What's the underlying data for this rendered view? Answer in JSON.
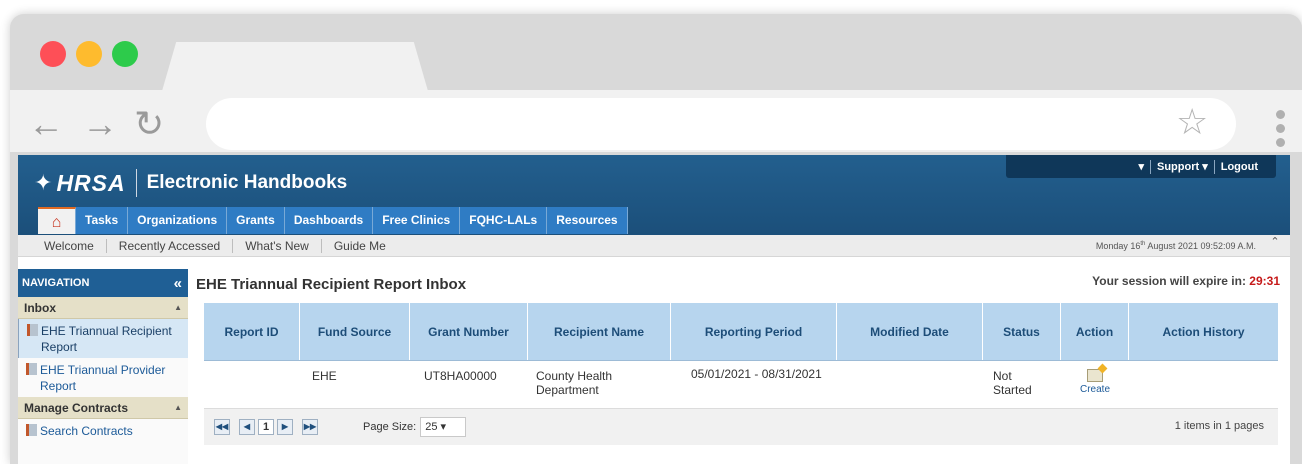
{
  "header": {
    "logo_text": "HRSA",
    "app_title": "Electronic Handbooks",
    "support": "Support",
    "logout": "Logout"
  },
  "menu": [
    "Tasks",
    "Organizations",
    "Grants",
    "Dashboards",
    "Free Clinics",
    "FQHC-LALs",
    "Resources"
  ],
  "subnav": [
    "Welcome",
    "Recently Accessed",
    "What's New",
    "Guide Me"
  ],
  "date": {
    "day_prefix": "Monday 16",
    "suffix": "th",
    "rest": " August 2021 09:52:09 A.M."
  },
  "sidebar": {
    "title": "NAVIGATION",
    "inbox_label": "Inbox",
    "inbox_items": [
      "EHE Triannual Recipient Report",
      "EHE Triannual Provider Report"
    ],
    "contracts_label": "Manage Contracts",
    "contracts_items": [
      "Search Contracts"
    ]
  },
  "main": {
    "title": "EHE Triannual Recipient Report Inbox",
    "session_label": "Your session will expire in:",
    "session_time": "29:31"
  },
  "grid": {
    "columns": [
      "Report ID",
      "Fund Source",
      "Grant Number",
      "Recipient Name",
      "Reporting Period",
      "Modified Date",
      "Status",
      "Action",
      "Action History"
    ],
    "rows": [
      {
        "report_id": "",
        "fund_source": "EHE",
        "grant_number": "UT8HA00000",
        "recipient_name": "County Health Department",
        "reporting_period": "05/01/2021 - 08/31/2021",
        "modified_date": "",
        "status": "Not Started",
        "action": "Create",
        "action_history": ""
      }
    ]
  },
  "pager": {
    "current_page": "1",
    "page_size_label": "Page Size:",
    "page_size": "25",
    "info": "1 items in 1 pages"
  }
}
